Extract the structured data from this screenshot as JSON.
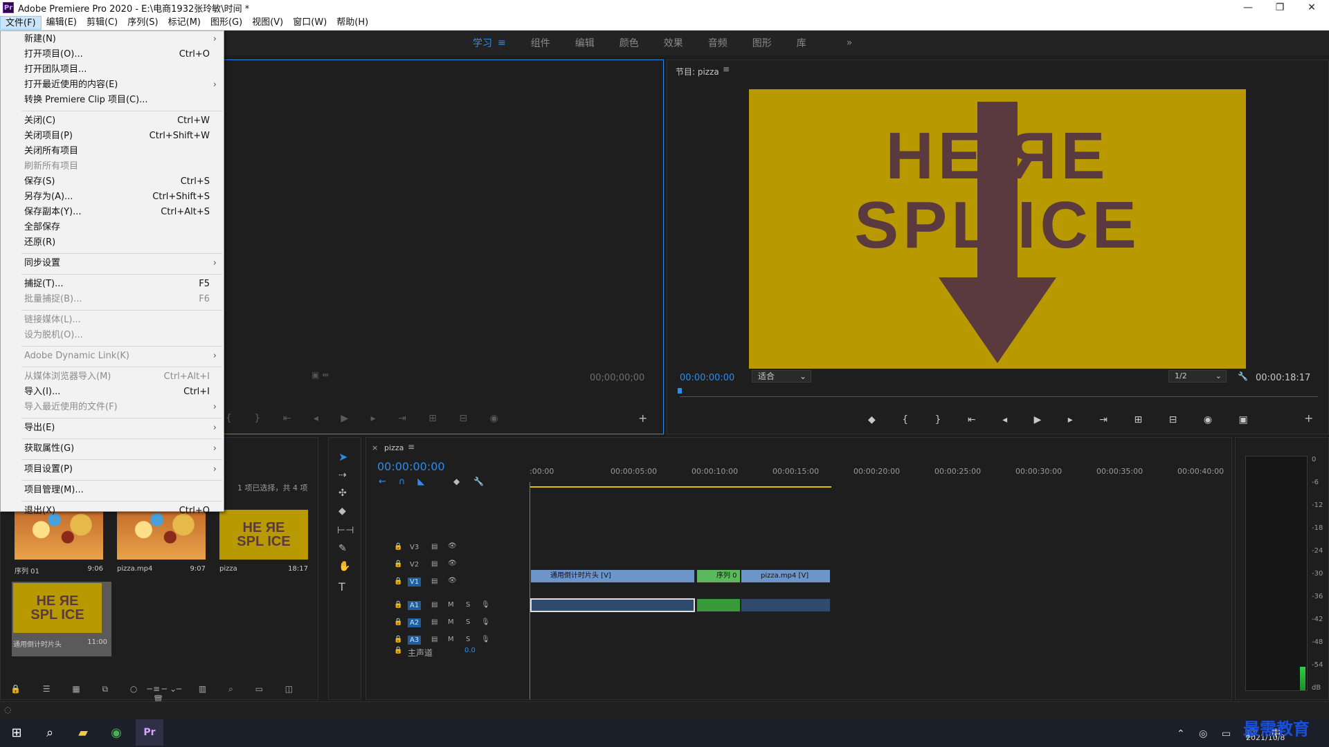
{
  "window": {
    "title": "Adobe Premiere Pro 2020 - E:\\电商1932张玲敏\\时间 *",
    "app_icon": "Pr"
  },
  "menubar": [
    "文件(F)",
    "编辑(E)",
    "剪辑(C)",
    "序列(S)",
    "标记(M)",
    "图形(G)",
    "视图(V)",
    "窗口(W)",
    "帮助(H)"
  ],
  "workspaces": [
    "学习",
    "组件",
    "编辑",
    "颜色",
    "效果",
    "音频",
    "图形",
    "库"
  ],
  "file_menu": [
    {
      "label": "新建(N)",
      "shortcut": "",
      "submenu": true,
      "disabled": false
    },
    {
      "label": "打开项目(O)...",
      "shortcut": "Ctrl+O",
      "submenu": false,
      "disabled": false
    },
    {
      "label": "打开团队项目...",
      "shortcut": "",
      "submenu": false,
      "disabled": false
    },
    {
      "label": "打开最近使用的内容(E)",
      "shortcut": "",
      "submenu": true,
      "disabled": false
    },
    {
      "label": "转换 Premiere Clip 项目(C)...",
      "shortcut": "",
      "submenu": false,
      "disabled": false
    },
    {
      "label": "关闭(C)",
      "shortcut": "Ctrl+W",
      "submenu": false,
      "disabled": false
    },
    {
      "label": "关闭项目(P)",
      "shortcut": "Ctrl+Shift+W",
      "submenu": false,
      "disabled": false
    },
    {
      "label": "关闭所有项目",
      "shortcut": "",
      "submenu": false,
      "disabled": false
    },
    {
      "label": "刷新所有项目",
      "shortcut": "",
      "submenu": false,
      "disabled": true
    },
    {
      "label": "保存(S)",
      "shortcut": "Ctrl+S",
      "submenu": false,
      "disabled": false
    },
    {
      "label": "另存为(A)...",
      "shortcut": "Ctrl+Shift+S",
      "submenu": false,
      "disabled": false
    },
    {
      "label": "保存副本(Y)...",
      "shortcut": "Ctrl+Alt+S",
      "submenu": false,
      "disabled": false
    },
    {
      "label": "全部保存",
      "shortcut": "",
      "submenu": false,
      "disabled": false
    },
    {
      "label": "还原(R)",
      "shortcut": "",
      "submenu": false,
      "disabled": false
    },
    {
      "label": "同步设置",
      "shortcut": "",
      "submenu": true,
      "disabled": false
    },
    {
      "label": "捕捉(T)...",
      "shortcut": "F5",
      "submenu": false,
      "disabled": false
    },
    {
      "label": "批量捕捉(B)...",
      "shortcut": "F6",
      "submenu": false,
      "disabled": true
    },
    {
      "label": "链接媒体(L)...",
      "shortcut": "",
      "submenu": false,
      "disabled": true
    },
    {
      "label": "设为脱机(O)...",
      "shortcut": "",
      "submenu": false,
      "disabled": true
    },
    {
      "label": "Adobe Dynamic Link(K)",
      "shortcut": "",
      "submenu": true,
      "disabled": true
    },
    {
      "label": "从媒体浏览器导入(M)",
      "shortcut": "Ctrl+Alt+I",
      "submenu": false,
      "disabled": true
    },
    {
      "label": "导入(I)...",
      "shortcut": "Ctrl+I",
      "submenu": false,
      "disabled": false
    },
    {
      "label": "导入最近使用的文件(F)",
      "shortcut": "",
      "submenu": true,
      "disabled": true
    },
    {
      "label": "导出(E)",
      "shortcut": "",
      "submenu": true,
      "disabled": false
    },
    {
      "label": "获取属性(G)",
      "shortcut": "",
      "submenu": true,
      "disabled": false
    },
    {
      "label": "项目设置(P)",
      "shortcut": "",
      "submenu": true,
      "disabled": false
    },
    {
      "label": "项目管理(M)...",
      "shortcut": "",
      "submenu": false,
      "disabled": false
    },
    {
      "label": "退出(X)",
      "shortcut": "Ctrl+Q",
      "submenu": false,
      "disabled": false
    }
  ],
  "source_monitor": {
    "timecode": "00;00;00;00"
  },
  "program_monitor": {
    "title": "节目: pizza",
    "timecode": "00:00:00:00",
    "fit": "适合",
    "resolution": "1/2",
    "duration": "00:00:18:17",
    "frame_text_top": "HE ЯE",
    "frame_text_bottom": "SPL ICE"
  },
  "project": {
    "selection_info": "1 项已选择，共 4 项",
    "bins": [
      {
        "name": "序列 01",
        "duration": "9:06",
        "kind": "pizza"
      },
      {
        "name": "pizza.mp4",
        "duration": "9:07",
        "kind": "pizza"
      },
      {
        "name": "pizza",
        "duration": "18:17",
        "kind": "yellow"
      },
      {
        "name": "通用倒计时片头",
        "duration": "11:00",
        "kind": "yellow"
      }
    ]
  },
  "timeline": {
    "tab": "pizza",
    "timecode": "00:00:00:00",
    "ruler": [
      ":00:00",
      "00:00:05:00",
      "00:00:10:00",
      "00:00:15:00",
      "00:00:20:00",
      "00:00:25:00",
      "00:00:30:00",
      "00:00:35:00",
      "00:00:40:00"
    ],
    "video_tracks": [
      "V3",
      "V2",
      "V1"
    ],
    "audio_tracks": [
      "A1",
      "A2",
      "A3"
    ],
    "master_label": "主声道",
    "master_value": "0.0",
    "clips": [
      {
        "label": "通用倒计时片头 [V]",
        "track": "V1",
        "color": "#6e95c9"
      },
      {
        "label": "序列 0",
        "track": "V1",
        "color": "#5cb85c"
      },
      {
        "label": "pizza.mp4 [V]",
        "track": "V1",
        "color": "#6e95c9"
      }
    ],
    "mute_label": "M",
    "solo_label": "S"
  },
  "audio_meter": {
    "scale": [
      "0",
      "-6",
      "-12",
      "-18",
      "-24",
      "-30",
      "-36",
      "-42",
      "-48",
      "-54",
      "dB"
    ],
    "level": 0.1
  },
  "taskbar": {
    "time": "",
    "date": "2021/10/8",
    "ime": "中",
    "watermark": "最需教育"
  },
  "colors": {
    "accent": "#2d8ceb",
    "yellow": "#b89a00",
    "arrow": "#5a3a3e",
    "green": "#5cb85c",
    "clipblue": "#6e95c9"
  }
}
